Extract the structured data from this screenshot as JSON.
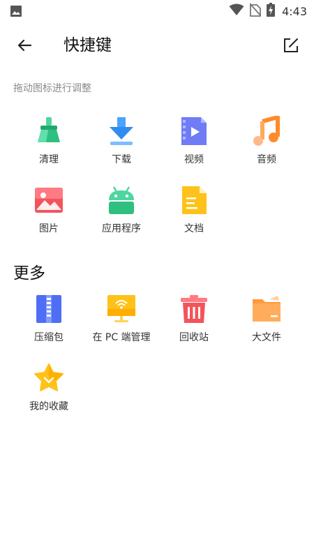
{
  "status": {
    "time": "4:43"
  },
  "header": {
    "title": "快捷键"
  },
  "hint": "拖动图标进行调整",
  "shortcuts": [
    {
      "label": "清理",
      "icon": "broom-icon"
    },
    {
      "label": "下载",
      "icon": "download-icon"
    },
    {
      "label": "视频",
      "icon": "video-icon"
    },
    {
      "label": "音频",
      "icon": "music-icon"
    },
    {
      "label": "图片",
      "icon": "picture-icon"
    },
    {
      "label": "应用程序",
      "icon": "android-icon"
    },
    {
      "label": "文档",
      "icon": "document-icon"
    }
  ],
  "more": {
    "title": "更多",
    "items": [
      {
        "label": "压缩包",
        "icon": "zip-icon"
      },
      {
        "label": "在 PC 端管理",
        "icon": "pc-wifi-icon"
      },
      {
        "label": "回收站",
        "icon": "trash-icon"
      },
      {
        "label": "大文件",
        "icon": "folder-icon"
      },
      {
        "label": "我的收藏",
        "icon": "star-icon"
      }
    ]
  },
  "colors": {
    "green": "#35c48a",
    "blue": "#2f8cf0",
    "purple": "#6f7cf5",
    "orange": "#ff9a3c",
    "red": "#f2545b",
    "yellow": "#ffc21a"
  }
}
